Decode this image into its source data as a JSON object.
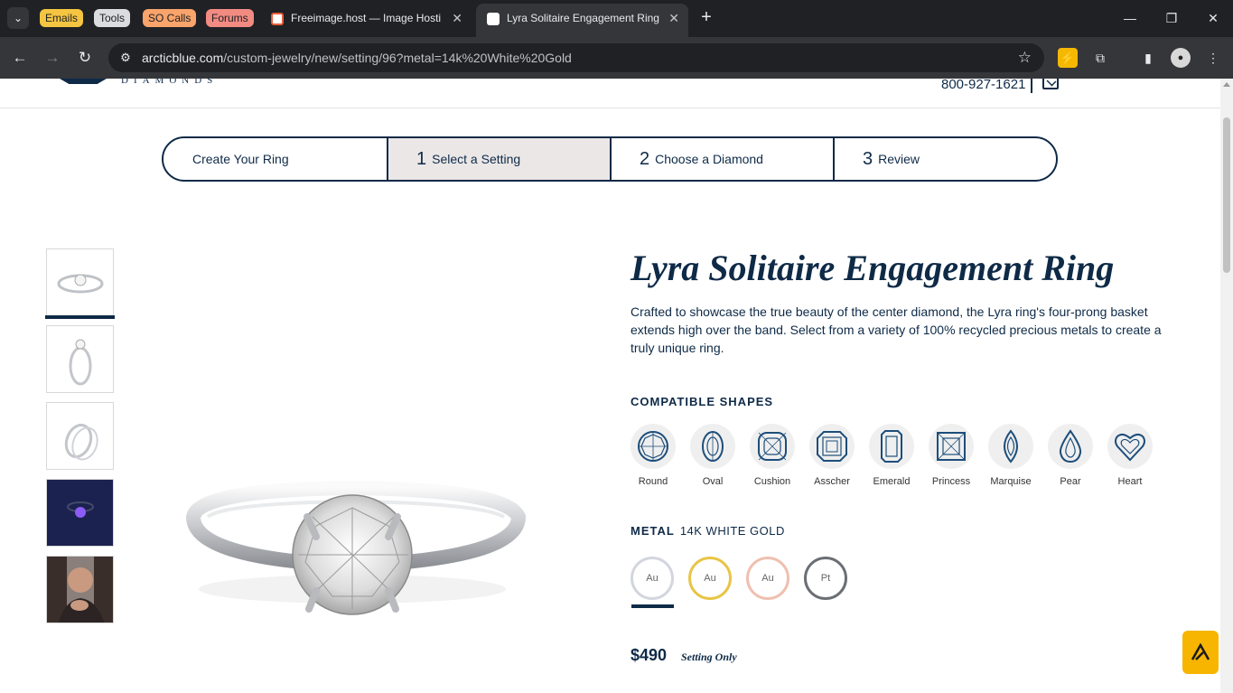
{
  "browser": {
    "tab_groups": [
      {
        "label": "Emails",
        "color": "#f5c542"
      },
      {
        "label": "Tools",
        "color": "#dadce0"
      },
      {
        "label": "SO Calls",
        "color": "#f9a46b"
      },
      {
        "label": "Forums",
        "color": "#f28b82"
      }
    ],
    "tabs": [
      {
        "title": "Freeimage.host — Image Hosti"
      },
      {
        "title": "Lyra Solitaire Engagement Ring"
      }
    ],
    "url_host": "arcticblue.com",
    "url_path": "/custom-jewelry/new/setting/96?metal=14k%20White%20Gold"
  },
  "header": {
    "logo_text": "DIAMONDS",
    "phone": "800-927-1621"
  },
  "steps": [
    {
      "num": "",
      "label": "Create Your Ring"
    },
    {
      "num": "1",
      "label": "Select a Setting"
    },
    {
      "num": "2",
      "label": "Choose a Diamond"
    },
    {
      "num": "3",
      "label": "Review"
    }
  ],
  "product": {
    "title": "Lyra Solitaire Engagement Ring",
    "description": "Crafted to showcase the true beauty of the center diamond, the Lyra ring's four-prong basket extends high over the band. Select from a variety of 100% recycled precious metals to create a truly unique ring.",
    "shapes_label": "COMPATIBLE SHAPES",
    "shapes": [
      "Round",
      "Oval",
      "Cushion",
      "Asscher",
      "Emerald",
      "Princess",
      "Marquise",
      "Pear",
      "Heart"
    ],
    "metal_label": "METAL",
    "metal_selected": "14K WHITE GOLD",
    "metals": [
      {
        "symbol": "Au",
        "color": "#d3d6de"
      },
      {
        "symbol": "Au",
        "color": "#e8c547"
      },
      {
        "symbol": "Au",
        "color": "#efc0b0"
      },
      {
        "symbol": "Pt",
        "color": "#6b6f74"
      }
    ],
    "price": "$490",
    "price_note": "Setting Only"
  }
}
